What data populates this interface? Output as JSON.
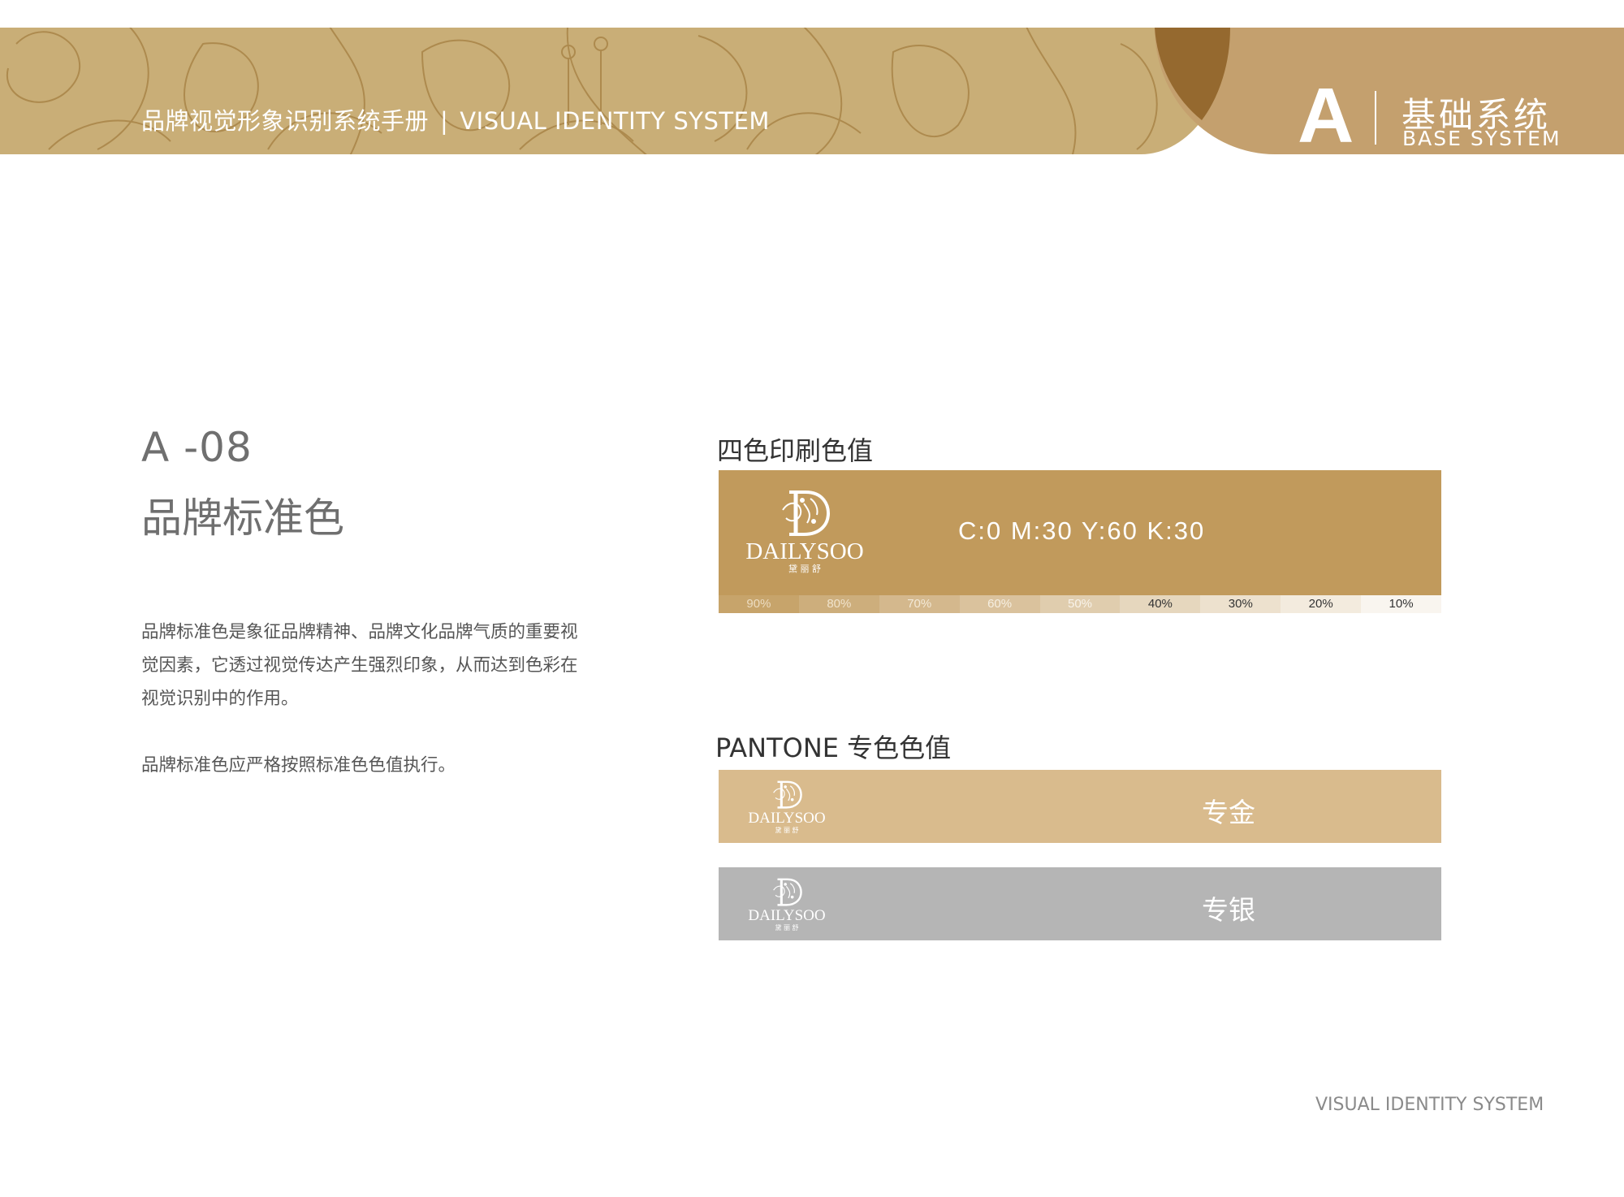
{
  "header": {
    "title_cn": "品牌视觉形象识别系统手册",
    "separator": "|",
    "title_en": "VISUAL IDENTITY SYSTEM",
    "section_letter": "A",
    "section_cn": "基础系统",
    "section_en": "BASE SYSTEM"
  },
  "section": {
    "code": "A -08",
    "title": "品牌标准色",
    "description": "品牌标准色是象征品牌精神、品牌文化品牌气质的重要视觉因素，它透过视觉传达产生强烈印象，从而达到色彩在视觉识别中的作用。",
    "note": "品牌标准色应严格按照标准色色值执行。"
  },
  "cmyk": {
    "label": "四色印刷色值",
    "value": "C:0  M:30  Y:60  K:30",
    "tints": [
      "90%",
      "80%",
      "70%",
      "60%",
      "50%",
      "40%",
      "30%",
      "20%",
      "10%"
    ]
  },
  "logo": {
    "wordmark": "DAILYSOO",
    "cn": "黛 丽 舒"
  },
  "pantone": {
    "label": "PANTONE 专色色值",
    "gold": "专金",
    "silver": "专银"
  },
  "colors": {
    "brand": "#c19a5c",
    "header_tan": "#c9ae77",
    "header_brown": "#c4a06e",
    "header_dark": "#95692f",
    "pantone_gold": "#d9bb8d",
    "pantone_silver": "#b5b5b5"
  },
  "footer": {
    "text": "VISUAL IDENTITY SYSTEM"
  }
}
